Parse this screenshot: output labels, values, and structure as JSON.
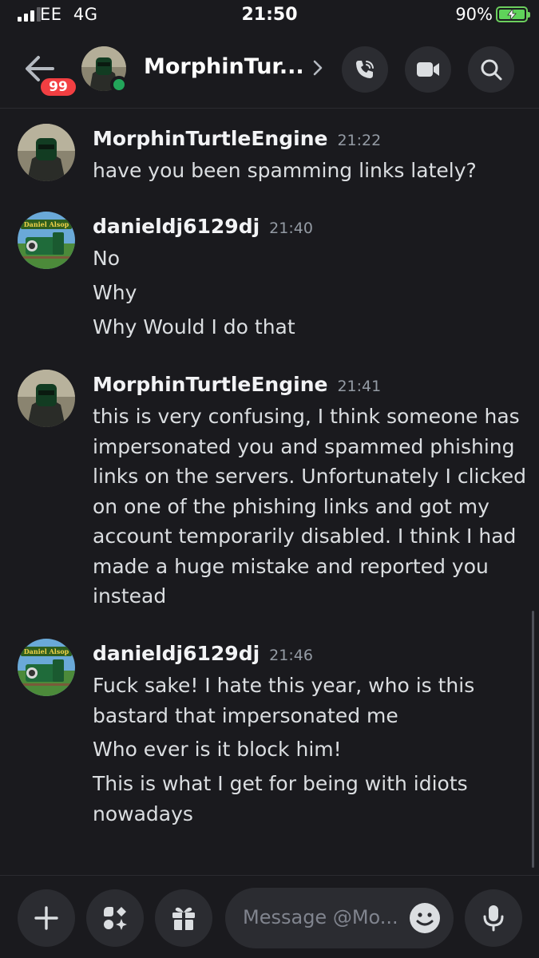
{
  "status_bar": {
    "carrier": "EE",
    "network": "4G",
    "time": "21:50",
    "battery": "90%",
    "battery_level": 0.9
  },
  "header": {
    "unread_badge": "99",
    "title": "MorphinTur...",
    "online": true,
    "icons": [
      "back-arrow-icon",
      "chevron-right-icon",
      "phone-call-icon",
      "video-camera-icon",
      "search-icon"
    ]
  },
  "messages": [
    {
      "author": "MorphinTurtleEngine",
      "time": "21:22",
      "lines": [
        "have you been spamming links lately?"
      ]
    },
    {
      "author": "danieldj6129dj",
      "time": "21:40",
      "avatar_text": "Daniel Alsop",
      "lines": [
        "No",
        "Why",
        "Why Would I do that"
      ]
    },
    {
      "author": "MorphinTurtleEngine",
      "time": "21:41",
      "lines": [
        "this is very confusing, I think someone has",
        "impersonated you and spammed phishing",
        "links on the servers. Unfortunately I clicked",
        "on one of the phishing links and got my",
        "account temporarily disabled. I think I had",
        "made a huge mistake and reported you",
        "instead"
      ]
    },
    {
      "author": "danieldj6129dj",
      "time": "21:46",
      "avatar_text": "Daniel Alsop",
      "lines": [
        "Fuck sake! I hate this year, who is this",
        "bastard that impersonated me",
        "Who ever is it block him!",
        "This is what I get for being with idiots",
        "nowadays"
      ]
    }
  ],
  "composer": {
    "placeholder": "Message @Mo...",
    "icons": [
      "plus-icon",
      "apps-icon",
      "gift-icon",
      "emoji-icon",
      "microphone-icon"
    ]
  },
  "colors": {
    "background": "#1a1a1e",
    "online": "#23a55a",
    "badge": "#f23f42",
    "battery": "#5fd35a"
  }
}
